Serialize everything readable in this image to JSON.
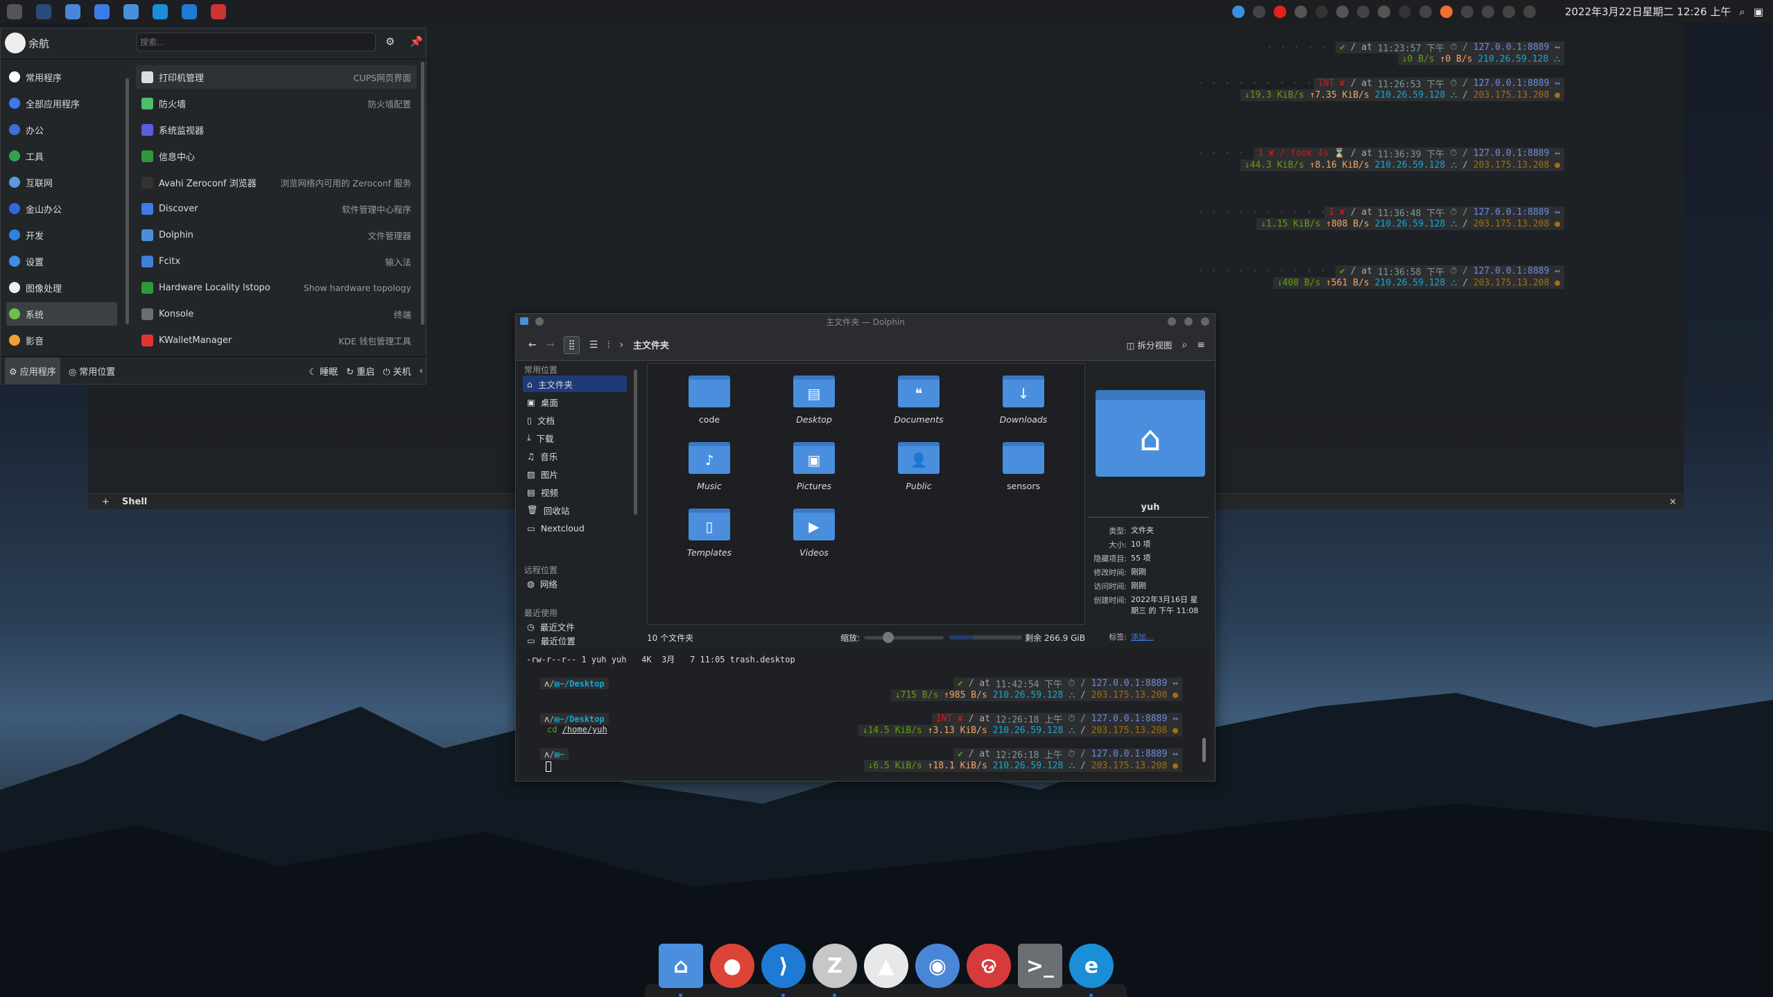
{
  "topbar": {
    "left_icons": [
      "apple-icon",
      "workspace-icon",
      "toggle-app-icon",
      "discover-icon",
      "dolphin-icon",
      "edge-icon",
      "vscode-icon",
      "zotero-icon"
    ],
    "tray_icons": [
      "info-icon",
      "pause-icon",
      "netease-music-icon",
      "flame-icon",
      "d-icon",
      "check-icon",
      "network-icon",
      "s-curve-icon",
      "terminal-icon",
      "clipboard-icon",
      "s-app-icon",
      "screen-icon",
      "code-icon",
      "volume-icon",
      "phone-icon",
      "caret-down-icon"
    ],
    "datetime": "2022年3月22日星期二 12:26 上午"
  },
  "launcher": {
    "user": "余航",
    "search_placeholder": "搜索...",
    "categories": [
      {
        "label": "常用程序",
        "color": "#ffffff"
      },
      {
        "label": "全部应用程序",
        "color": "#3d7be8"
      },
      {
        "label": "办公",
        "color": "#3d6fd8"
      },
      {
        "label": "工具",
        "color": "#2ea44f"
      },
      {
        "label": "互联网",
        "color": "#5b9ae0"
      },
      {
        "label": "金山办公",
        "color": "#3466e0"
      },
      {
        "label": "开发",
        "color": "#2f80e0"
      },
      {
        "label": "设置",
        "color": "#3d8ee8"
      },
      {
        "label": "图像处理",
        "color": "#eeeeee"
      },
      {
        "label": "系统",
        "color": "#6fc04a"
      },
      {
        "label": "影音",
        "color": "#f0a030"
      }
    ],
    "selected_category": "系统",
    "apps": [
      {
        "name": "打印机管理",
        "desc": "CUPS网页界面",
        "color": "#dddddd"
      },
      {
        "name": "防火墙",
        "desc": "防火墙配置",
        "color": "#4cbf6a"
      },
      {
        "name": "系统监视器",
        "desc": "",
        "color": "#5a5ee0"
      },
      {
        "name": "信息中心",
        "desc": "",
        "color": "#2e9a3a"
      },
      {
        "name": "Avahi Zeroconf 浏览器",
        "desc": "浏览网络内可用的 Zeroconf 服务",
        "color": "#333333"
      },
      {
        "name": "Discover",
        "desc": "软件管理中心程序",
        "color": "#3d7be8"
      },
      {
        "name": "Dolphin",
        "desc": "文件管理器",
        "color": "#4a8fde"
      },
      {
        "name": "Fcitx",
        "desc": "输入法",
        "color": "#3d80d8"
      },
      {
        "name": "Hardware Locality lstopo",
        "desc": "Show hardware topology",
        "color": "#2e9a3a"
      },
      {
        "name": "Konsole",
        "desc": "终端",
        "color": "#6b6e72"
      },
      {
        "name": "KWalletManager",
        "desc": "KDE 钱包管理工具",
        "color": "#e03535"
      }
    ],
    "footer": {
      "apps": "应用程序",
      "places": "常用位置",
      "sleep": "睡眠",
      "restart": "重启",
      "shutdown": "关机"
    }
  },
  "terminal": {
    "tab_add": "+",
    "tab": "Shell",
    "prompts": [
      {
        "status": "✔",
        "status_color": "g",
        "time": "11:23:57 下午",
        "down": "↓0 B/s",
        "up": "↑0 B/s",
        "lan": "210.26.59.128",
        "wan": ""
      },
      {
        "status": "INT ✘",
        "status_color": "r",
        "time": "11:26:53 下午",
        "down": "↓19.3 KiB/s",
        "up": "↑7.35 KiB/s",
        "lan": "210.26.59.128",
        "wan": "203.175.13.208"
      },
      {
        "status": "1 ✘ / took 4s ⌛",
        "status_color": "r",
        "time": "11:36:39 下午",
        "down": "↓44.3 KiB/s",
        "up": "↑8.16 KiB/s",
        "lan": "210.26.59.128",
        "wan": "203.175.13.208"
      },
      {
        "status": "1 ✘",
        "status_color": "r",
        "time": "11:36:48 下午",
        "down": "↓1.15 KiB/s",
        "up": "↑808 B/s",
        "lan": "210.26.59.128",
        "wan": "203.175.13.208"
      },
      {
        "status": "✔",
        "status_color": "g",
        "time": "11:36:58 下午",
        "down": "↓408 B/s",
        "up": "↑561 B/s",
        "lan": "210.26.59.128",
        "wan": "203.175.13.208"
      }
    ],
    "proxy": "127.0.0.1:8889",
    "at": "at"
  },
  "dolphin": {
    "title": "主文件夹 — Dolphin",
    "breadcrumb": "主文件夹",
    "split_view": "拆分视图",
    "sidebar": {
      "places_header": "常用位置",
      "places": [
        "主文件夹",
        "桌面",
        "文档",
        "下载",
        "音乐",
        "图片",
        "视频",
        "回收站",
        "Nextcloud"
      ],
      "remote_header": "远程位置",
      "remote": [
        "网络"
      ],
      "recent_header": "最近使用",
      "recent": [
        "最近文件",
        "最近位置"
      ]
    },
    "folders": [
      {
        "name": "code",
        "italic": false,
        "glyph": ""
      },
      {
        "name": "Desktop",
        "italic": true,
        "glyph": "▤"
      },
      {
        "name": "Documents",
        "italic": true,
        "glyph": "❝"
      },
      {
        "name": "Downloads",
        "italic": true,
        "glyph": "↓"
      },
      {
        "name": "Music",
        "italic": true,
        "glyph": "♪"
      },
      {
        "name": "Pictures",
        "italic": true,
        "glyph": "▣"
      },
      {
        "name": "Public",
        "italic": true,
        "glyph": "👤"
      },
      {
        "name": "sensors",
        "italic": false,
        "glyph": ""
      },
      {
        "name": "Templates",
        "italic": true,
        "glyph": "▯"
      },
      {
        "name": "Videos",
        "italic": true,
        "glyph": "▶"
      }
    ],
    "info": {
      "name": "yuh",
      "rows": [
        {
          "k": "类型:",
          "v": "文件夹"
        },
        {
          "k": "大小:",
          "v": "10 项"
        },
        {
          "k": "隐藏项目:",
          "v": "55 项"
        },
        {
          "k": "修改时间:",
          "v": "刚刚"
        },
        {
          "k": "访问时间:",
          "v": "刚刚"
        },
        {
          "k": "创建时间:",
          "v": "2022年3月16日 星期三 的 下午 11:08"
        }
      ],
      "tags_label": "标签:",
      "tags_link": "添加..."
    },
    "status": {
      "count": "10 个文件夹",
      "zoom_label": "缩放:",
      "zoom_level": 0.3,
      "free": "剩余 266.9 GiB",
      "disk_used_fraction": 0.33
    },
    "terminal": {
      "ls_line": "-rw-r--r-- 1 yuh yuh   4K  3月   7 11:05 trash.desktop",
      "prompts": [
        {
          "path": "~/Desktop",
          "cmd": "",
          "arg": "",
          "status": "✔",
          "status_color": "g",
          "time": "11:42:54 下午",
          "down": "↓715 B/s",
          "up": "↑985 B/s"
        },
        {
          "path": "~/Desktop",
          "cmd": "cd",
          "arg": "/home/yuh",
          "status": "INT ✘",
          "status_color": "r",
          "time": "12:26:18 上午",
          "down": "↓14.5 KiB/s",
          "up": "↑3.13 KiB/s"
        },
        {
          "path": "~",
          "cmd": "",
          "arg": "",
          "status": "✔",
          "status_color": "g",
          "time": "12:26:18 上午",
          "down": "↓6.5 KiB/s",
          "up": "↑18.1 KiB/s"
        }
      ],
      "lan": "210.26.59.128",
      "wan": "203.175.13.208",
      "proxy": "127.0.0.1:8889",
      "at": "at"
    }
  },
  "dock": [
    {
      "name": "dolphin",
      "color": "#4a8fde",
      "glyph": "⌂",
      "running": true
    },
    {
      "name": "chrome",
      "color": "#db4437",
      "glyph": "●",
      "running": false
    },
    {
      "name": "vscode",
      "color": "#1f7ad3",
      "glyph": "⟩",
      "running": true
    },
    {
      "name": "zotero",
      "color": "#c7c7c7",
      "glyph": "Z",
      "running": true
    },
    {
      "name": "matlab",
      "color": "#e8e8e8",
      "glyph": "▲",
      "running": false
    },
    {
      "name": "toggle",
      "color": "#4a86d8",
      "glyph": "◉",
      "running": false
    },
    {
      "name": "netease-music",
      "color": "#d63a3a",
      "glyph": "ଡ",
      "running": false
    },
    {
      "name": "terminal",
      "color": "#6b6e72",
      "glyph": ">_",
      "running": false
    },
    {
      "name": "edge",
      "color": "#1a8fd8",
      "glyph": "e",
      "running": true
    }
  ]
}
